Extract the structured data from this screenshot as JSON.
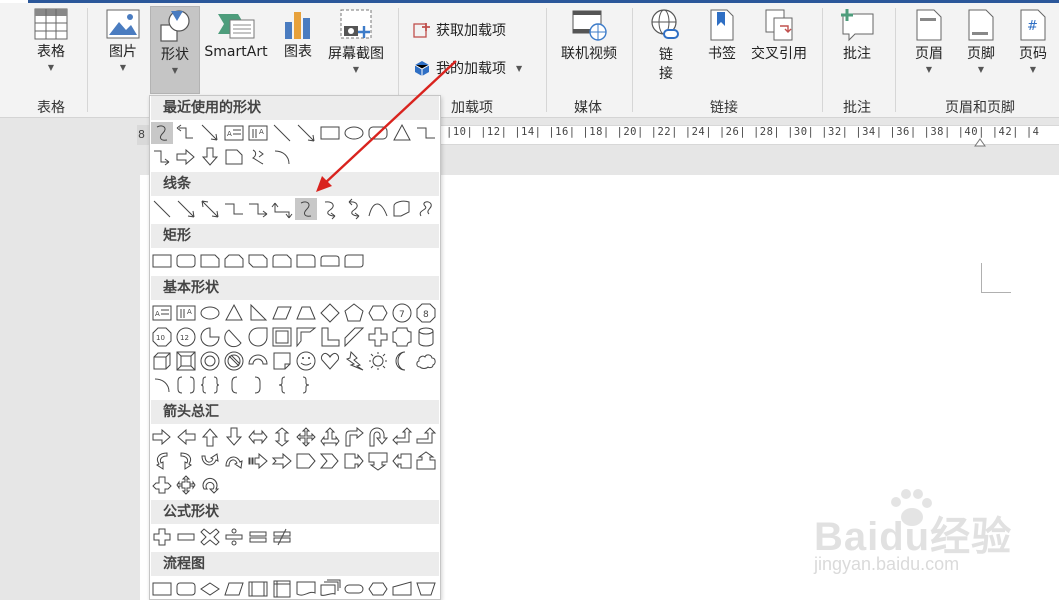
{
  "ribbon": {
    "groups": [
      {
        "label": "表格"
      },
      {
        "label": "加载项"
      },
      {
        "label": "媒体"
      },
      {
        "label": "链接"
      },
      {
        "label": "批注"
      },
      {
        "label": "页眉和页脚"
      }
    ],
    "buttons": {
      "table": "表格",
      "picture": "图片",
      "shapes": "形状",
      "smartart": "SmartArt",
      "chart": "图表",
      "screenshot": "屏幕截图",
      "get_addins": "获取加载项",
      "my_addins": "我的加载项",
      "online_video": "联机视频",
      "link": "链\n接",
      "bookmark": "书签",
      "cross_ref": "交叉引用",
      "comment": "批注",
      "header": "页眉",
      "footer": "页脚",
      "page_number": "页码"
    },
    "accent_color": "#2b579a"
  },
  "ruler": {
    "left_label": "8",
    "ticks": "|10| |12| |14| |16| |18| |20| |22| |24| |26| |28| |30| |32| |34| |36| |38| |40| |42| |4"
  },
  "shapes_menu": {
    "categories": [
      {
        "label": "最近使用的形状"
      },
      {
        "label": "线条"
      },
      {
        "label": "矩形"
      },
      {
        "label": "基本形状"
      },
      {
        "label": "箭头总汇"
      },
      {
        "label": "公式形状"
      },
      {
        "label": "流程图"
      }
    ]
  },
  "watermark": {
    "text": "Baidu经验",
    "url": "jingyan.baidu.com"
  },
  "annotation_color": "#d9231e"
}
